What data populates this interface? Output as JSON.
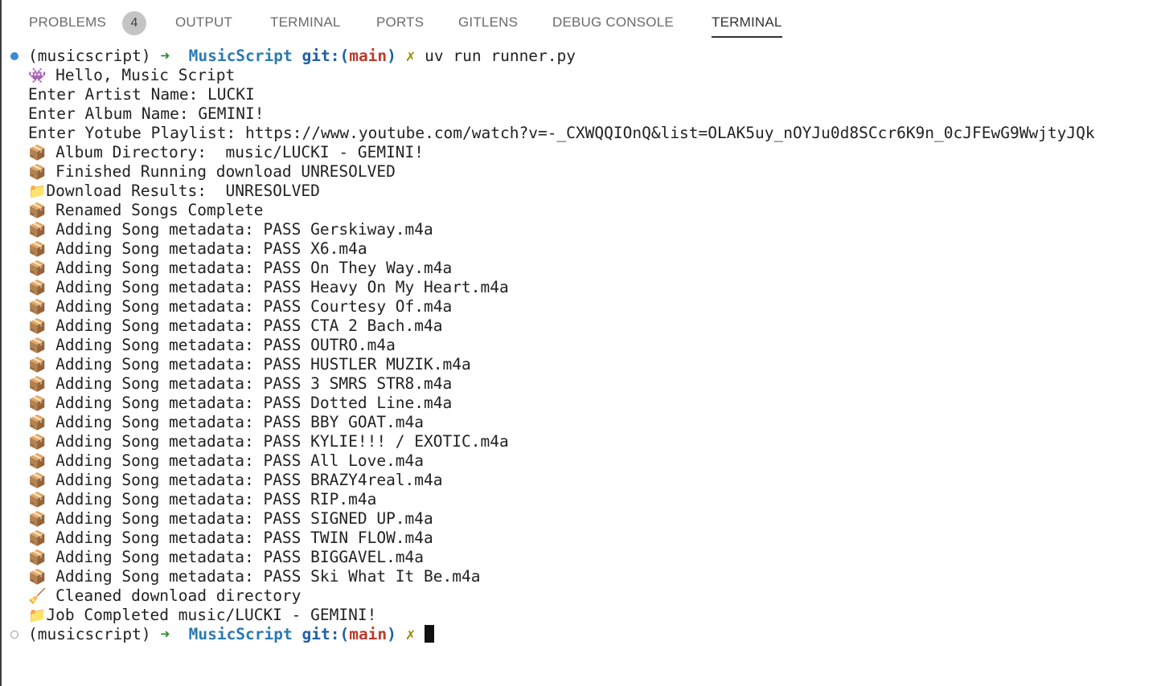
{
  "tabs": [
    {
      "label": "PROBLEMS",
      "badge": "4"
    },
    {
      "label": "OUTPUT"
    },
    {
      "label": "TERMINAL"
    },
    {
      "label": "PORTS"
    },
    {
      "label": "GITLENS"
    },
    {
      "label": "DEBUG CONSOLE"
    },
    {
      "label": "TERMINAL",
      "active": true
    }
  ],
  "prompt": {
    "env": "(musicscript)",
    "arrow": "➜",
    "project": "MusicScript",
    "git_label": "git:(",
    "branch": "main",
    "git_close": ")",
    "dirty": "✗"
  },
  "command": "uv run runner.py",
  "output": [
    {
      "icon": "👾",
      "text": "Hello, Music Script"
    },
    {
      "icon": "",
      "text": "Enter Artist Name: LUCKI"
    },
    {
      "icon": "",
      "text": "Enter Album Name: GEMINI!"
    },
    {
      "icon": "",
      "text": "Enter Yotube Playlist: https://www.youtube.com/watch?v=-_CXWQQIOnQ&list=OLAK5uy_nOYJu0d8SCcr6K9n_0cJFEwG9WwjtyJQk"
    },
    {
      "icon": "📦",
      "text": "Album Directory:  music/LUCKI - GEMINI!"
    },
    {
      "icon": "📦",
      "text": "Finished Running download UNRESOLVED"
    },
    {
      "icon": "📁",
      "text": "Download Results:  UNRESOLVED"
    },
    {
      "icon": "📦",
      "text": "Renamed Songs Complete"
    },
    {
      "icon": "📦",
      "text": "Adding Song metadata: PASS Gerskiway.m4a"
    },
    {
      "icon": "📦",
      "text": "Adding Song metadata: PASS X6.m4a"
    },
    {
      "icon": "📦",
      "text": "Adding Song metadata: PASS On They Way.m4a"
    },
    {
      "icon": "📦",
      "text": "Adding Song metadata: PASS Heavy On My Heart.m4a"
    },
    {
      "icon": "📦",
      "text": "Adding Song metadata: PASS Courtesy Of.m4a"
    },
    {
      "icon": "📦",
      "text": "Adding Song metadata: PASS CTA 2 Bach.m4a"
    },
    {
      "icon": "📦",
      "text": "Adding Song metadata: PASS OUTRO.m4a"
    },
    {
      "icon": "📦",
      "text": "Adding Song metadata: PASS HUSTLER MUZIK.m4a"
    },
    {
      "icon": "📦",
      "text": "Adding Song metadata: PASS 3 SMRS STR8.m4a"
    },
    {
      "icon": "📦",
      "text": "Adding Song metadata: PASS Dotted Line.m4a"
    },
    {
      "icon": "📦",
      "text": "Adding Song metadata: PASS BBY GOAT.m4a"
    },
    {
      "icon": "📦",
      "text": "Adding Song metadata: PASS KYLIE!!! / EXOTIC.m4a"
    },
    {
      "icon": "📦",
      "text": "Adding Song metadata: PASS All Love.m4a"
    },
    {
      "icon": "📦",
      "text": "Adding Song metadata: PASS BRAZY4real.m4a"
    },
    {
      "icon": "📦",
      "text": "Adding Song metadata: PASS RIP.m4a"
    },
    {
      "icon": "📦",
      "text": "Adding Song metadata: PASS SIGNED UP.m4a"
    },
    {
      "icon": "📦",
      "text": "Adding Song metadata: PASS TWIN FLOW.m4a"
    },
    {
      "icon": "📦",
      "text": "Adding Song metadata: PASS BIGGAVEL.m4a"
    },
    {
      "icon": "📦",
      "text": "Adding Song metadata: PASS Ski What It Be.m4a"
    },
    {
      "icon": "🧹",
      "text": "Cleaned download directory"
    },
    {
      "icon": "📁",
      "text": "Job Completed music/LUCKI - GEMINI!"
    }
  ]
}
